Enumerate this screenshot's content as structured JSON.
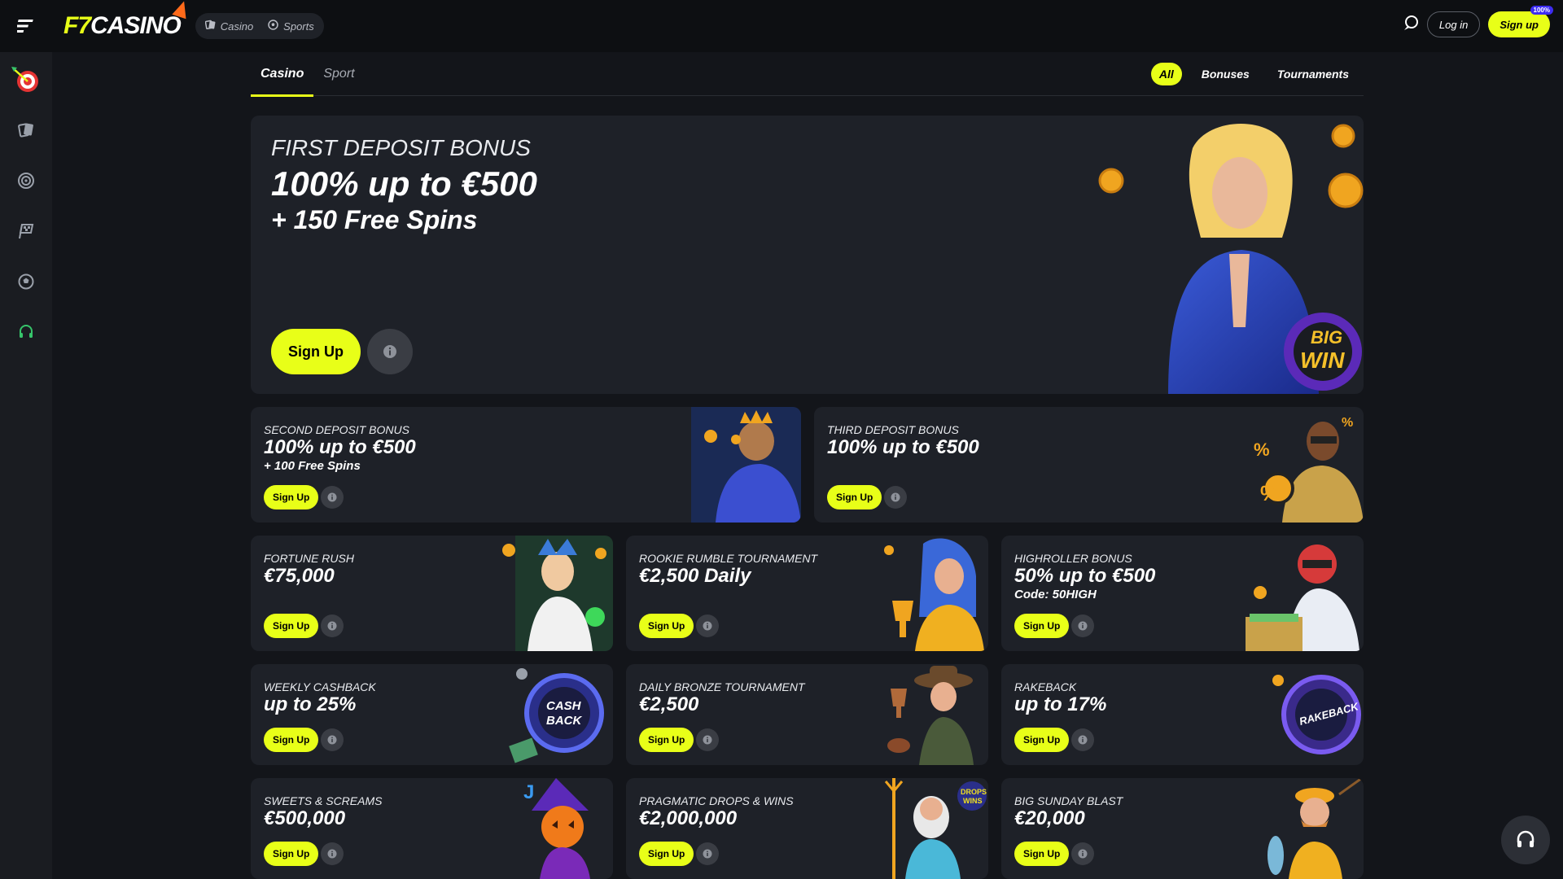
{
  "header": {
    "brand_f7": "F7",
    "brand_casino": "CASINO",
    "modes": [
      {
        "label": "Casino",
        "icon": "cards-icon"
      },
      {
        "label": "Sports",
        "icon": "soccer-ball-icon"
      }
    ],
    "login_label": "Log in",
    "signup_label": "Sign up",
    "signup_badge": "100%",
    "accent_color": "#e8ff18"
  },
  "sidebar": {
    "items": [
      "dart-target-icon",
      "cards-icon",
      "roulette-icon",
      "racing-flag-icon",
      "soccer-ball-icon",
      "headset-icon"
    ]
  },
  "tabs": {
    "items": [
      {
        "label": "Casino",
        "active": true
      },
      {
        "label": "Sport",
        "active": false
      }
    ],
    "filters": [
      {
        "label": "All",
        "active": true
      },
      {
        "label": "Bonuses",
        "active": false
      },
      {
        "label": "Tournaments",
        "active": false
      }
    ]
  },
  "hero": {
    "title": "FIRST DEPOSIT BONUS",
    "value": "100% up to €500",
    "sub": "+ 150 Free Spins",
    "button": "Sign Up"
  },
  "cards": [
    {
      "title": "SECOND DEPOSIT BONUS",
      "value": "100% up to €500",
      "sub": "+ 100 Free Spins",
      "button": "Sign Up"
    },
    {
      "title": "THIRD DEPOSIT BONUS",
      "value": "100% up to €500",
      "sub": "",
      "button": "Sign Up"
    },
    {
      "title": "FORTUNE RUSH",
      "value": "€75,000",
      "sub": "",
      "button": "Sign Up"
    },
    {
      "title": "ROOKIE RUMBLE TOURNAMENT",
      "value": "€2,500 Daily",
      "sub": "",
      "button": "Sign Up"
    },
    {
      "title": "HIGHROLLER BONUS",
      "value": "50% up to €500",
      "sub": "Code: 50HIGH",
      "button": "Sign Up"
    },
    {
      "title": "WEEKLY CASHBACK",
      "value": "up to 25%",
      "sub": "",
      "button": "Sign Up"
    },
    {
      "title": "DAILY BRONZE TOURNAMENT",
      "value": "€2,500",
      "sub": "",
      "button": "Sign Up"
    },
    {
      "title": "RAKEBACK",
      "value": "up to 17%",
      "sub": "",
      "button": "Sign Up"
    },
    {
      "title": "SWEETS & SCREAMS",
      "value": "€500,000",
      "sub": "",
      "button": "Sign Up"
    },
    {
      "title": "PRAGMATIC DROPS & WINS",
      "value": "€2,000,000",
      "sub": "",
      "button": "Sign Up"
    },
    {
      "title": "BIG SUNDAY BLAST",
      "value": "€20,000",
      "sub": "",
      "button": "Sign Up"
    }
  ],
  "art_text": {
    "hero_badge_1": "BIG",
    "hero_badge_2": "WIN",
    "cashback_1": "CASH",
    "cashback_2": "BACK",
    "rakeback": "RAKEBACK",
    "drops_1": "DROPS",
    "drops_2": "WINS"
  }
}
